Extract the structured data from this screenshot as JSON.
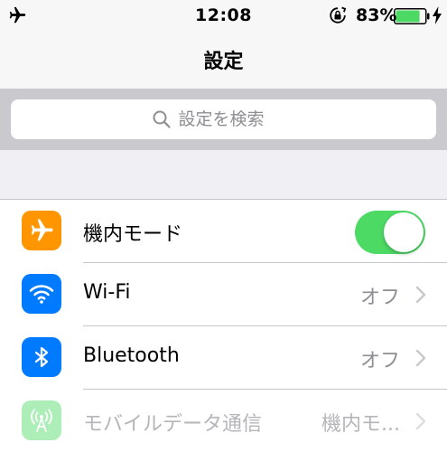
{
  "status_bar": {
    "time": "12:08",
    "battery_percent": "83%",
    "battery_level": 0.83,
    "icons": [
      "airplane-icon",
      "rotation-lock-icon",
      "battery-icon",
      "charging-bolt-icon"
    ]
  },
  "nav": {
    "title": "設定"
  },
  "search": {
    "placeholder": "設定を検索"
  },
  "settings": {
    "items": [
      {
        "label": "機内モード",
        "icon": "airplane-icon",
        "icon_color": "#ff9500",
        "toggle_on": true
      },
      {
        "label": "Wi-Fi",
        "value": "オフ",
        "icon": "wifi-icon",
        "icon_color": "#007aff"
      },
      {
        "label": "Bluetooth",
        "value": "オフ",
        "icon": "bluetooth-icon",
        "icon_color": "#007aff"
      },
      {
        "label": "モバイルデータ通信",
        "value": "機内モ...",
        "icon": "cellular-icon",
        "icon_color": "#4cd964",
        "dimmed": true
      }
    ]
  },
  "colors": {
    "toggle_on": "#4cd964",
    "battery_fill": "#4cd964",
    "secondary_text": "#8e8e93"
  }
}
